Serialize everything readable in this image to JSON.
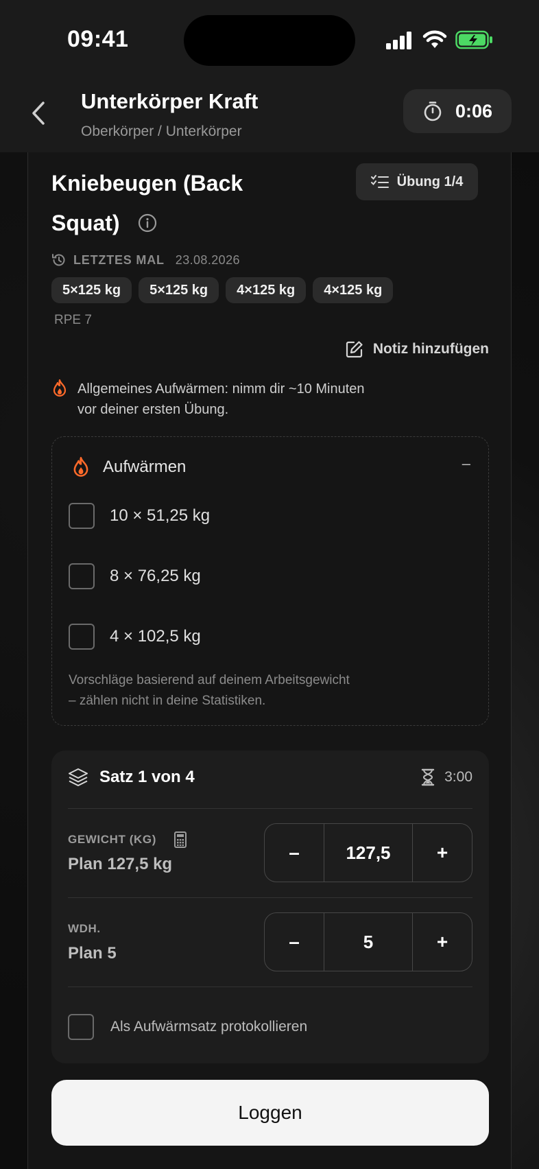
{
  "status_bar": {
    "time": "09:41"
  },
  "header": {
    "title": "Unterkörper Kraft",
    "subtitle": "Oberkörper / Unterkörper",
    "timer": "0:06"
  },
  "exercise": {
    "title": "Kniebeugen (Back Squat)",
    "progress_label": "Übung 1/4",
    "last_time_label": "LETZTES MAL",
    "last_time_date": "23.08.2026",
    "last_sets": [
      "5×125 kg",
      "5×125 kg",
      "4×125 kg",
      "4×125 kg"
    ],
    "rpe": "RPE 7",
    "add_note_label": "Notiz hinzufügen",
    "warmup_hint": "Allgemeines Aufwärmen: nimm dir ~10 Minuten\nvor deiner ersten Übung."
  },
  "warmup": {
    "title": "Aufwärmen",
    "collapse_symbol": "–",
    "sets": [
      "10 × 51,25 kg",
      "8 × 76,25 kg",
      "4 × 102,5 kg"
    ],
    "note": "Vorschläge basierend auf deinem Arbeitsgewicht\n– zählen nicht in deine Statistiken."
  },
  "set": {
    "title": "Satz 1 von 4",
    "rest": "3:00",
    "weight_label": "GEWICHT (KG)",
    "weight_plan": "Plan 127,5 kg",
    "weight_value": "127,5",
    "reps_label": "WDH.",
    "reps_plan": "Plan 5",
    "reps_value": "5",
    "minus": "–",
    "plus": "+",
    "warmup_checkbox_label": "Als Aufwärmsatz protokollieren"
  },
  "log_button": "Loggen",
  "colors": {
    "accent_orange": "#ff6a2a",
    "battery_green": "#4cd964"
  },
  "icons": [
    "back-chevron-icon",
    "stopwatch-icon",
    "info-icon",
    "checklist-icon",
    "history-icon",
    "edit-icon",
    "flame-icon",
    "layers-icon",
    "hourglass-icon",
    "calculator-icon"
  ]
}
